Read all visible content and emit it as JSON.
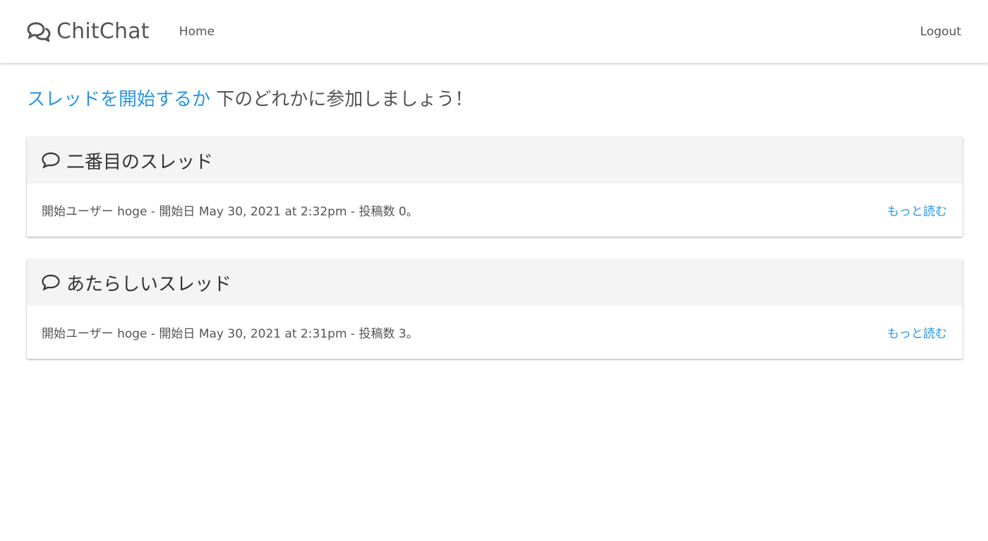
{
  "nav": {
    "brand": "ChitChat",
    "home_label": "Home",
    "logout_label": "Logout"
  },
  "headline": {
    "link_text": "スレッドを開始するか",
    "rest_text": " 下のどれかに参加しましょう！"
  },
  "threads": [
    {
      "title": "二番目のスレッド",
      "meta": "開始ユーザー hoge - 開始日 May 30, 2021 at 2:32pm - 投稿数 0。",
      "read_more": "もっと読む"
    },
    {
      "title": "あたらしいスレッド",
      "meta": "開始ユーザー hoge - 開始日 May 30, 2021 at 2:31pm - 投稿数 3。",
      "read_more": "もっと読む"
    }
  ],
  "icons": {
    "brand": "comments-icon",
    "thread": "comment-icon"
  },
  "colors": {
    "link": "#2a97e3",
    "text": "#555555",
    "card_header_bg": "#f4f4f4"
  }
}
